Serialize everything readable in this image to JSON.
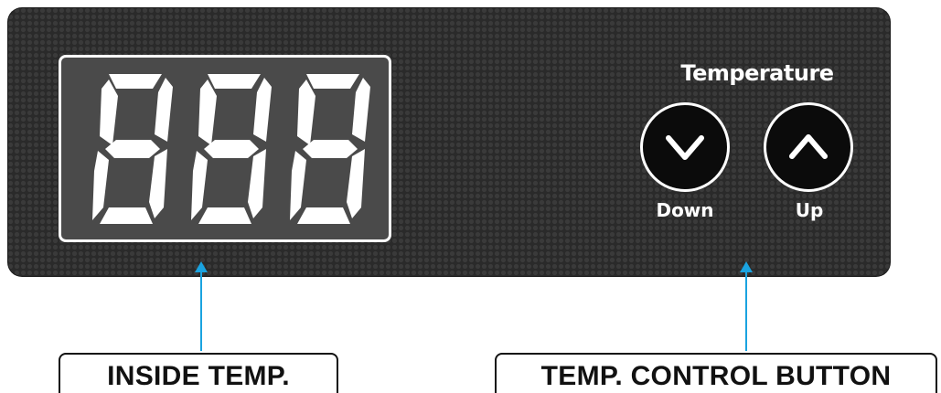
{
  "display": {
    "digits": [
      "8",
      "8",
      "8"
    ],
    "segment_color": "#ffffff",
    "background_color": "#4a4a4a"
  },
  "control": {
    "title": "Temperature",
    "down_label": "Down",
    "up_label": "Up",
    "down_icon": "chevron-down-icon",
    "up_icon": "chevron-up-icon"
  },
  "callouts": {
    "inside_temp": "INSIDE TEMP.",
    "control_button": "TEMP. CONTROL BUTTON",
    "arrow_color": "#1aa3e0"
  },
  "panel": {
    "texture": "carbon-fiber",
    "color": "#2a2a2a"
  }
}
